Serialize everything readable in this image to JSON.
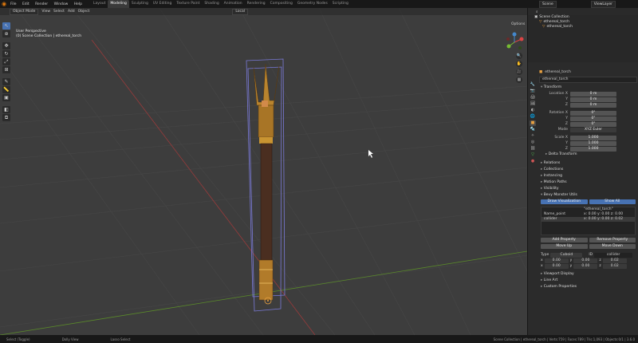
{
  "menu": [
    "File",
    "Edit",
    "Render",
    "Window",
    "Help"
  ],
  "workspaces": [
    "Layout",
    "Modeling",
    "Sculpting",
    "UV Editing",
    "Texture Paint",
    "Shading",
    "Animation",
    "Rendering",
    "Compositing",
    "Geometry Nodes",
    "Scripting"
  ],
  "active_workspace": "Modeling",
  "scene_name": "Scene",
  "view_layer": "ViewLayer",
  "viewport": {
    "mode": "Object Mode",
    "menus": [
      "View",
      "Select",
      "Add",
      "Object"
    ],
    "transform_orientation": "Local",
    "options_label": "Options",
    "view_name": "User Perspective",
    "collection_path": "(0) Scene Collection | ethereal_torch"
  },
  "outliner": {
    "root": "Scene Collection",
    "items": [
      "ethereal_torch",
      "ethereal_torch"
    ]
  },
  "properties": {
    "object_header": "ethereal_torch",
    "object_name": "ethereal_torch",
    "transform_label": "Transform",
    "location_label": "Location X",
    "rotation_label": "Rotation X",
    "scale_label": "Scale X",
    "y_label": "Y",
    "z_label": "Z",
    "location": [
      "0 m",
      "0 m",
      "0 m"
    ],
    "rotation": [
      "0°",
      "0°",
      "0°"
    ],
    "mode_label": "Mode",
    "rotation_mode": "XYZ Euler",
    "scale": [
      "1.000",
      "1.000",
      "1.000"
    ],
    "delta_transform": "Delta Transform",
    "sections": [
      "Relations",
      "Collections",
      "Instancing",
      "Motion Paths",
      "Visibility"
    ],
    "addon_section": "Bevy Monster Utils",
    "draw_viz": "Draw Visualization",
    "show_all": "Show All",
    "list_header": "\"ethereal_torch\"",
    "list_rows": [
      {
        "key": "Name_point",
        "value": "x: 0.00 y: 0.00 z: 0.00"
      },
      {
        "key": "collider",
        "value": "x: 0.00 y: 0.00 z: 0.02"
      }
    ],
    "add_property": "Add Property",
    "remove_property": "Remove Property",
    "move_up": "Move Up",
    "move_down": "Move Down",
    "type_label": "Type",
    "type_value": "Cuboid",
    "id_label": "ID",
    "id_value": "collider",
    "vec_row1": [
      "x",
      "0.00",
      "y",
      "0.00",
      "z",
      "0.02"
    ],
    "vec_row2": [
      "x",
      "0.00",
      "y",
      "0.00",
      "z",
      "0.02"
    ],
    "tail_sections": [
      "Viewport Display",
      "Line Art",
      "Custom Properties"
    ]
  },
  "status": {
    "left1": "Select (Toggle)",
    "left2": "Dolly View",
    "left3": "Lasso Select",
    "right": "Scene Collection | ethereal_torch | Verts:759 | Faces:789 | Tris:1,093 | Objects:0/1 | 3.6.0"
  }
}
